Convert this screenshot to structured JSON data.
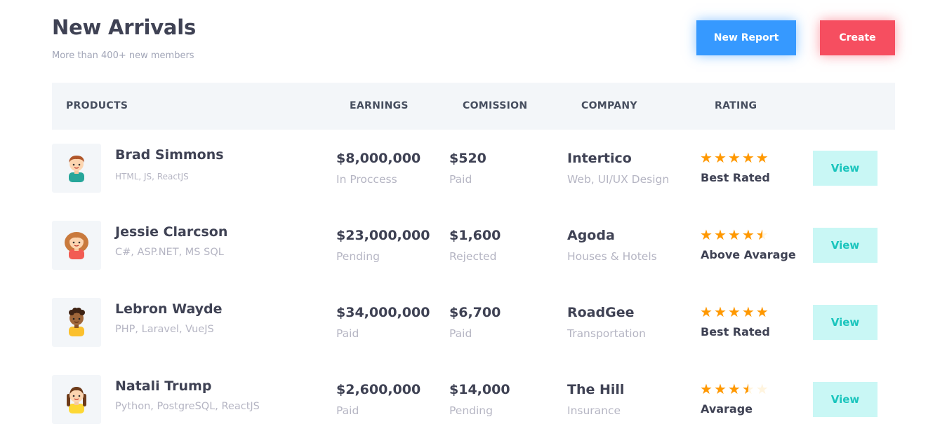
{
  "header": {
    "title": "New Arrivals",
    "subtitle": "More than 400+ new members",
    "new_report_label": "New Report",
    "create_label": "Create"
  },
  "colors": {
    "primary": "#3699ff",
    "danger": "#f64e60",
    "view_bg": "#c9f7f5",
    "view_text": "#1bc5bd",
    "star": "#ff9800"
  },
  "table": {
    "columns": [
      "PRODUCTS",
      "EARNINGS",
      "COMISSION",
      "COMPANY",
      "RATING"
    ],
    "rows": [
      {
        "avatar": "boy-avatar-icon",
        "name": "Brad Simmons",
        "skills": "HTML, JS, ReactJS",
        "earnings": "$8,000,000",
        "earnings_status": "In Proccess",
        "commission": "$520",
        "commission_status": "Paid",
        "company": "Intertico",
        "company_type": "Web, UI/UX Design",
        "rating": 5,
        "rating_label": "Best Rated",
        "action": "View"
      },
      {
        "avatar": "girl-avatar-icon",
        "name": "Jessie Clarcson",
        "skills": "C#, ASP.NET, MS SQL",
        "earnings": "$23,000,000",
        "earnings_status": "Pending",
        "commission": "$1,600",
        "commission_status": "Rejected",
        "company": "Agoda",
        "company_type": "Houses & Hotels",
        "rating": 4.5,
        "rating_label": "Above Avarage",
        "action": "View"
      },
      {
        "avatar": "boy-curly-avatar-icon",
        "name": "Lebron Wayde",
        "skills": "PHP, Laravel, VueJS",
        "earnings": "$34,000,000",
        "earnings_status": "Paid",
        "commission": "$6,700",
        "commission_status": "Paid",
        "company": "RoadGee",
        "company_type": "Transportation",
        "rating": 5,
        "rating_label": "Best Rated",
        "action": "View"
      },
      {
        "avatar": "girl-braids-avatar-icon",
        "name": "Natali Trump",
        "skills": "Python, PostgreSQL, ReactJS",
        "earnings": "$2,600,000",
        "earnings_status": "Paid",
        "commission": "$14,000",
        "commission_status": "Pending",
        "company": "The Hill",
        "company_type": "Insurance",
        "rating": 3.5,
        "rating_label": "Avarage",
        "action": "View"
      }
    ]
  }
}
